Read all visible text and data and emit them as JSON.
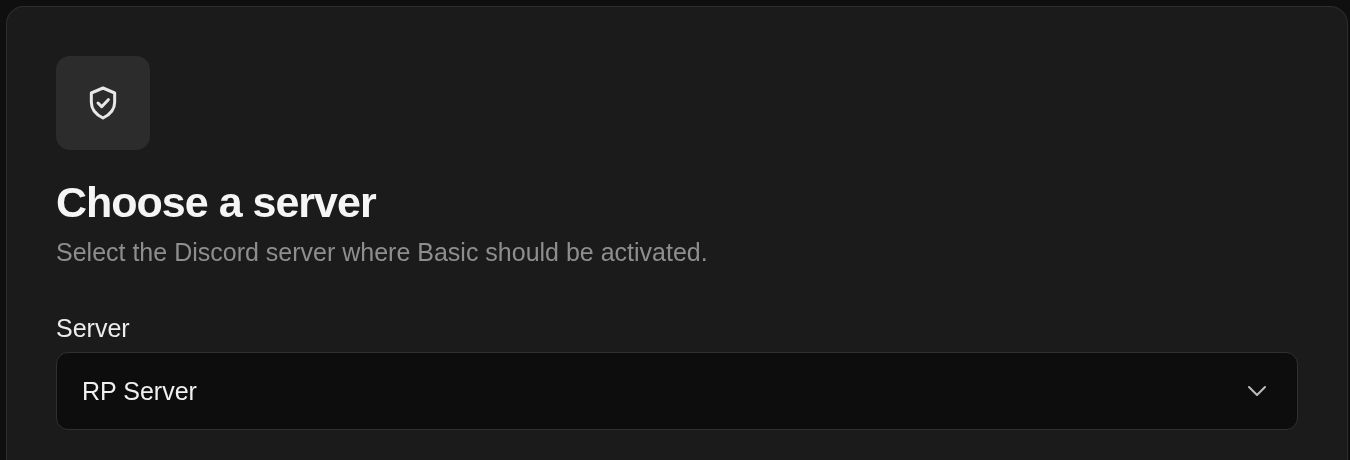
{
  "header": {
    "title": "Choose a server",
    "subtitle": "Select the Discord server where Basic should be activated."
  },
  "field": {
    "label": "Server",
    "value": "RP Server"
  }
}
